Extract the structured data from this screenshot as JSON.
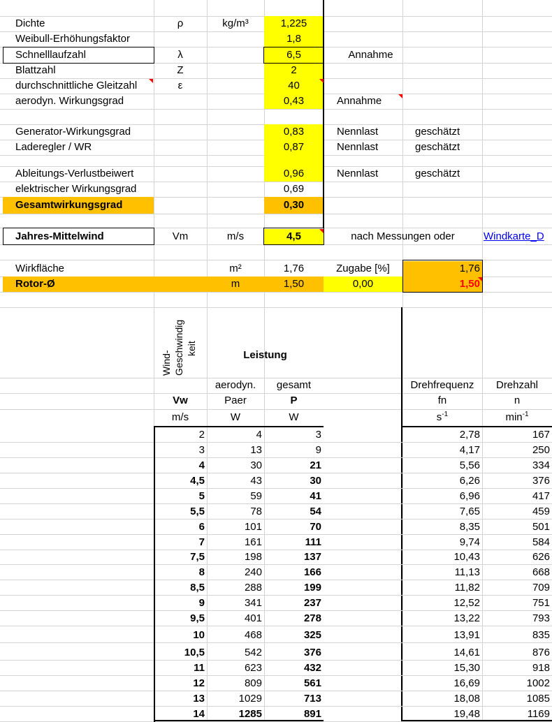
{
  "params": {
    "dichte": {
      "label": "Dichte",
      "symbol": "ρ",
      "unit": "kg/m³",
      "value": "1,225"
    },
    "weibull": {
      "label": "Weibull-Erhöhungsfaktor",
      "value": "1,8"
    },
    "schnelllaufzahl": {
      "label": "Schnelllaufzahl",
      "symbol": "λ",
      "value": "6,5",
      "note": "Annahme"
    },
    "blattzahl": {
      "label": "Blattzahl",
      "symbol": "Z",
      "value": "2"
    },
    "gleitzahl": {
      "label": "durchschnittliche Gleitzahl",
      "symbol": "ε",
      "value": "40"
    },
    "aerodyn": {
      "label": "aerodyn. Wirkungsgrad",
      "value": "0,43",
      "note": "Annahme"
    },
    "generator": {
      "label": "Generator-Wirkungsgrad",
      "value": "0,83",
      "load": "Nennlast",
      "note": "geschätzt"
    },
    "laderegler": {
      "label": "Laderegler / WR",
      "value": "0,87",
      "load": "Nennlast",
      "note": "geschätzt"
    },
    "ableitung": {
      "label": "Ableitungs-Verlustbeiwert",
      "value": "0,96",
      "load": "Nennlast",
      "note": "geschätzt"
    },
    "elektrisch": {
      "label": "elektrischer Wirkungsgrad",
      "value": "0,69"
    },
    "gesamt": {
      "label": "Gesamtwirkungsgrad",
      "value": "0,30"
    },
    "wind": {
      "label": "Jahres-Mittelwind",
      "symbol": "Vm",
      "unit": "m/s",
      "value": "4,5",
      "note": "nach Messungen oder",
      "link": "Windkarte_D"
    },
    "wirkflaeche": {
      "label": "Wirkfläche",
      "unit": "m²",
      "value": "1,76",
      "zugabe_label": "Zugabe [%]",
      "value2": "1,76"
    },
    "rotor": {
      "label": "Rotor-Ø",
      "unit": "m",
      "value": "1,50",
      "zugabe": "0,00",
      "result": "1,50"
    }
  },
  "table": {
    "vertical_header": [
      "Wind-",
      "Geschwindig",
      "keit"
    ],
    "header_leistung": "Leistung",
    "row1": {
      "aerodyn": "aerodyn.",
      "gesamt": "gesamt",
      "drehfrequenz": "Drehfrequenz",
      "drehzahl": "Drehzahl"
    },
    "row2": {
      "vw": "Vw",
      "paer": "Paer",
      "p": "P",
      "fn": "fn",
      "n": "n"
    },
    "row3": {
      "vw": "m/s",
      "paer": "W",
      "p": "W",
      "fn_base": "s",
      "fn_exp": "-1",
      "n_base": "min",
      "n_exp": "-1"
    },
    "rows": [
      {
        "vw": "2",
        "paer": "4",
        "p": "3",
        "fn": "2,78",
        "n": "167",
        "bold": false
      },
      {
        "vw": "3",
        "paer": "13",
        "p": "9",
        "fn": "4,17",
        "n": "250",
        "bold": false
      },
      {
        "vw": "4",
        "paer": "30",
        "p": "21",
        "fn": "5,56",
        "n": "334",
        "bold": true
      },
      {
        "vw": "4,5",
        "paer": "43",
        "p": "30",
        "fn": "6,26",
        "n": "376",
        "bold": true
      },
      {
        "vw": "5",
        "paer": "59",
        "p": "41",
        "fn": "6,96",
        "n": "417",
        "bold": true
      },
      {
        "vw": "5,5",
        "paer": "78",
        "p": "54",
        "fn": "7,65",
        "n": "459",
        "bold": true
      },
      {
        "vw": "6",
        "paer": "101",
        "p": "70",
        "fn": "8,35",
        "n": "501",
        "bold": true
      },
      {
        "vw": "7",
        "paer": "161",
        "p": "111",
        "fn": "9,74",
        "n": "584",
        "bold": true
      },
      {
        "vw": "7,5",
        "paer": "198",
        "p": "137",
        "fn": "10,43",
        "n": "626",
        "bold": true
      },
      {
        "vw": "8",
        "paer": "240",
        "p": "166",
        "fn": "11,13",
        "n": "668",
        "bold": true
      },
      {
        "vw": "8,5",
        "paer": "288",
        "p": "199",
        "fn": "11,82",
        "n": "709",
        "bold": true
      },
      {
        "vw": "9",
        "paer": "341",
        "p": "237",
        "fn": "12,52",
        "n": "751",
        "bold": true
      },
      {
        "vw": "9,5",
        "paer": "401",
        "p": "278",
        "fn": "13,22",
        "n": "793",
        "bold": true
      },
      {
        "vw": "10",
        "paer": "468",
        "p": "325",
        "fn": "13,91",
        "n": "835",
        "bold": true
      },
      {
        "vw": "10,5",
        "paer": "542",
        "p": "376",
        "fn": "14,61",
        "n": "876",
        "bold": true
      },
      {
        "vw": "11",
        "paer": "623",
        "p": "432",
        "fn": "15,30",
        "n": "918",
        "bold": true
      },
      {
        "vw": "12",
        "paer": "809",
        "p": "561",
        "fn": "16,69",
        "n": "1002",
        "bold": true
      },
      {
        "vw": "13",
        "paer": "1029",
        "p": "713",
        "fn": "18,08",
        "n": "1085",
        "bold": true
      },
      {
        "vw": "14",
        "paer": "1285",
        "p": "891",
        "fn": "19,48",
        "n": "1169",
        "bold": true
      }
    ]
  }
}
